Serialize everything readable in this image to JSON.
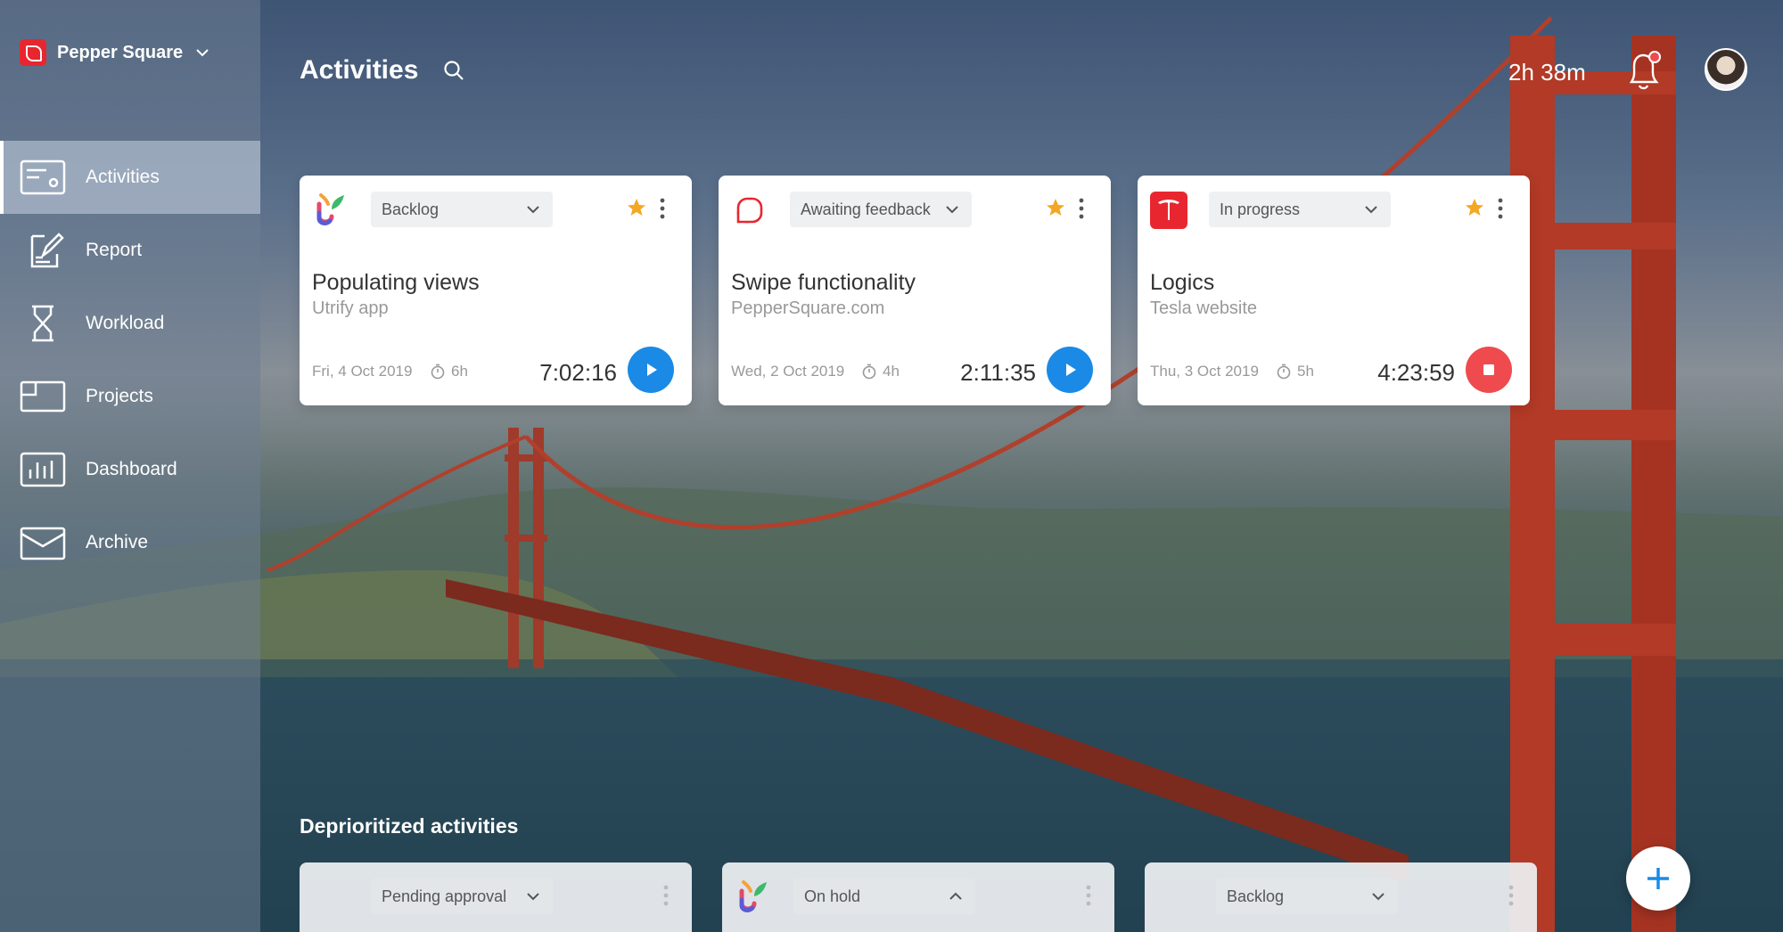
{
  "brand": {
    "name": "Pepper Square"
  },
  "sidebar": {
    "items": [
      {
        "label": "Activities",
        "icon": "activities-icon",
        "active": true
      },
      {
        "label": "Report",
        "icon": "report-icon"
      },
      {
        "label": "Workload",
        "icon": "hourglass-icon"
      },
      {
        "label": "Projects",
        "icon": "folder-icon"
      },
      {
        "label": "Dashboard",
        "icon": "bar-chart-icon"
      },
      {
        "label": "Archive",
        "icon": "archive-icon"
      }
    ]
  },
  "header": {
    "title": "Activities",
    "total_time": "2h 38m"
  },
  "cards": [
    {
      "status": "Backlog",
      "title": "Populating views",
      "project": "Utrify app",
      "date": "Fri, 4 Oct 2019",
      "estimate": "6h",
      "elapsed": "7:02:16",
      "action": "play",
      "logo": "utrify-logo"
    },
    {
      "status": "Awaiting feedback",
      "title": "Swipe functionality",
      "project": "PepperSquare.com",
      "date": "Wed, 2 Oct 2019",
      "estimate": "4h",
      "elapsed": "2:11:35",
      "action": "play",
      "logo": "peppersquare-logo"
    },
    {
      "status": "In progress",
      "title": "Logics",
      "project": "Tesla website",
      "date": "Thu, 3 Oct 2019",
      "estimate": "5h",
      "elapsed": "4:23:59",
      "action": "stop",
      "logo": "tesla-logo"
    }
  ],
  "deprioritized": {
    "title": "Deprioritized activities",
    "cards": [
      {
        "status": "Pending approval"
      },
      {
        "status": "On hold",
        "logo": "utrify-logo"
      },
      {
        "status": "Backlog"
      }
    ]
  },
  "colors": {
    "accent_blue": "#1a8ae6",
    "stop_red": "#ef4b4f",
    "star": "#f5a623",
    "brand_red": "#e8262f"
  }
}
